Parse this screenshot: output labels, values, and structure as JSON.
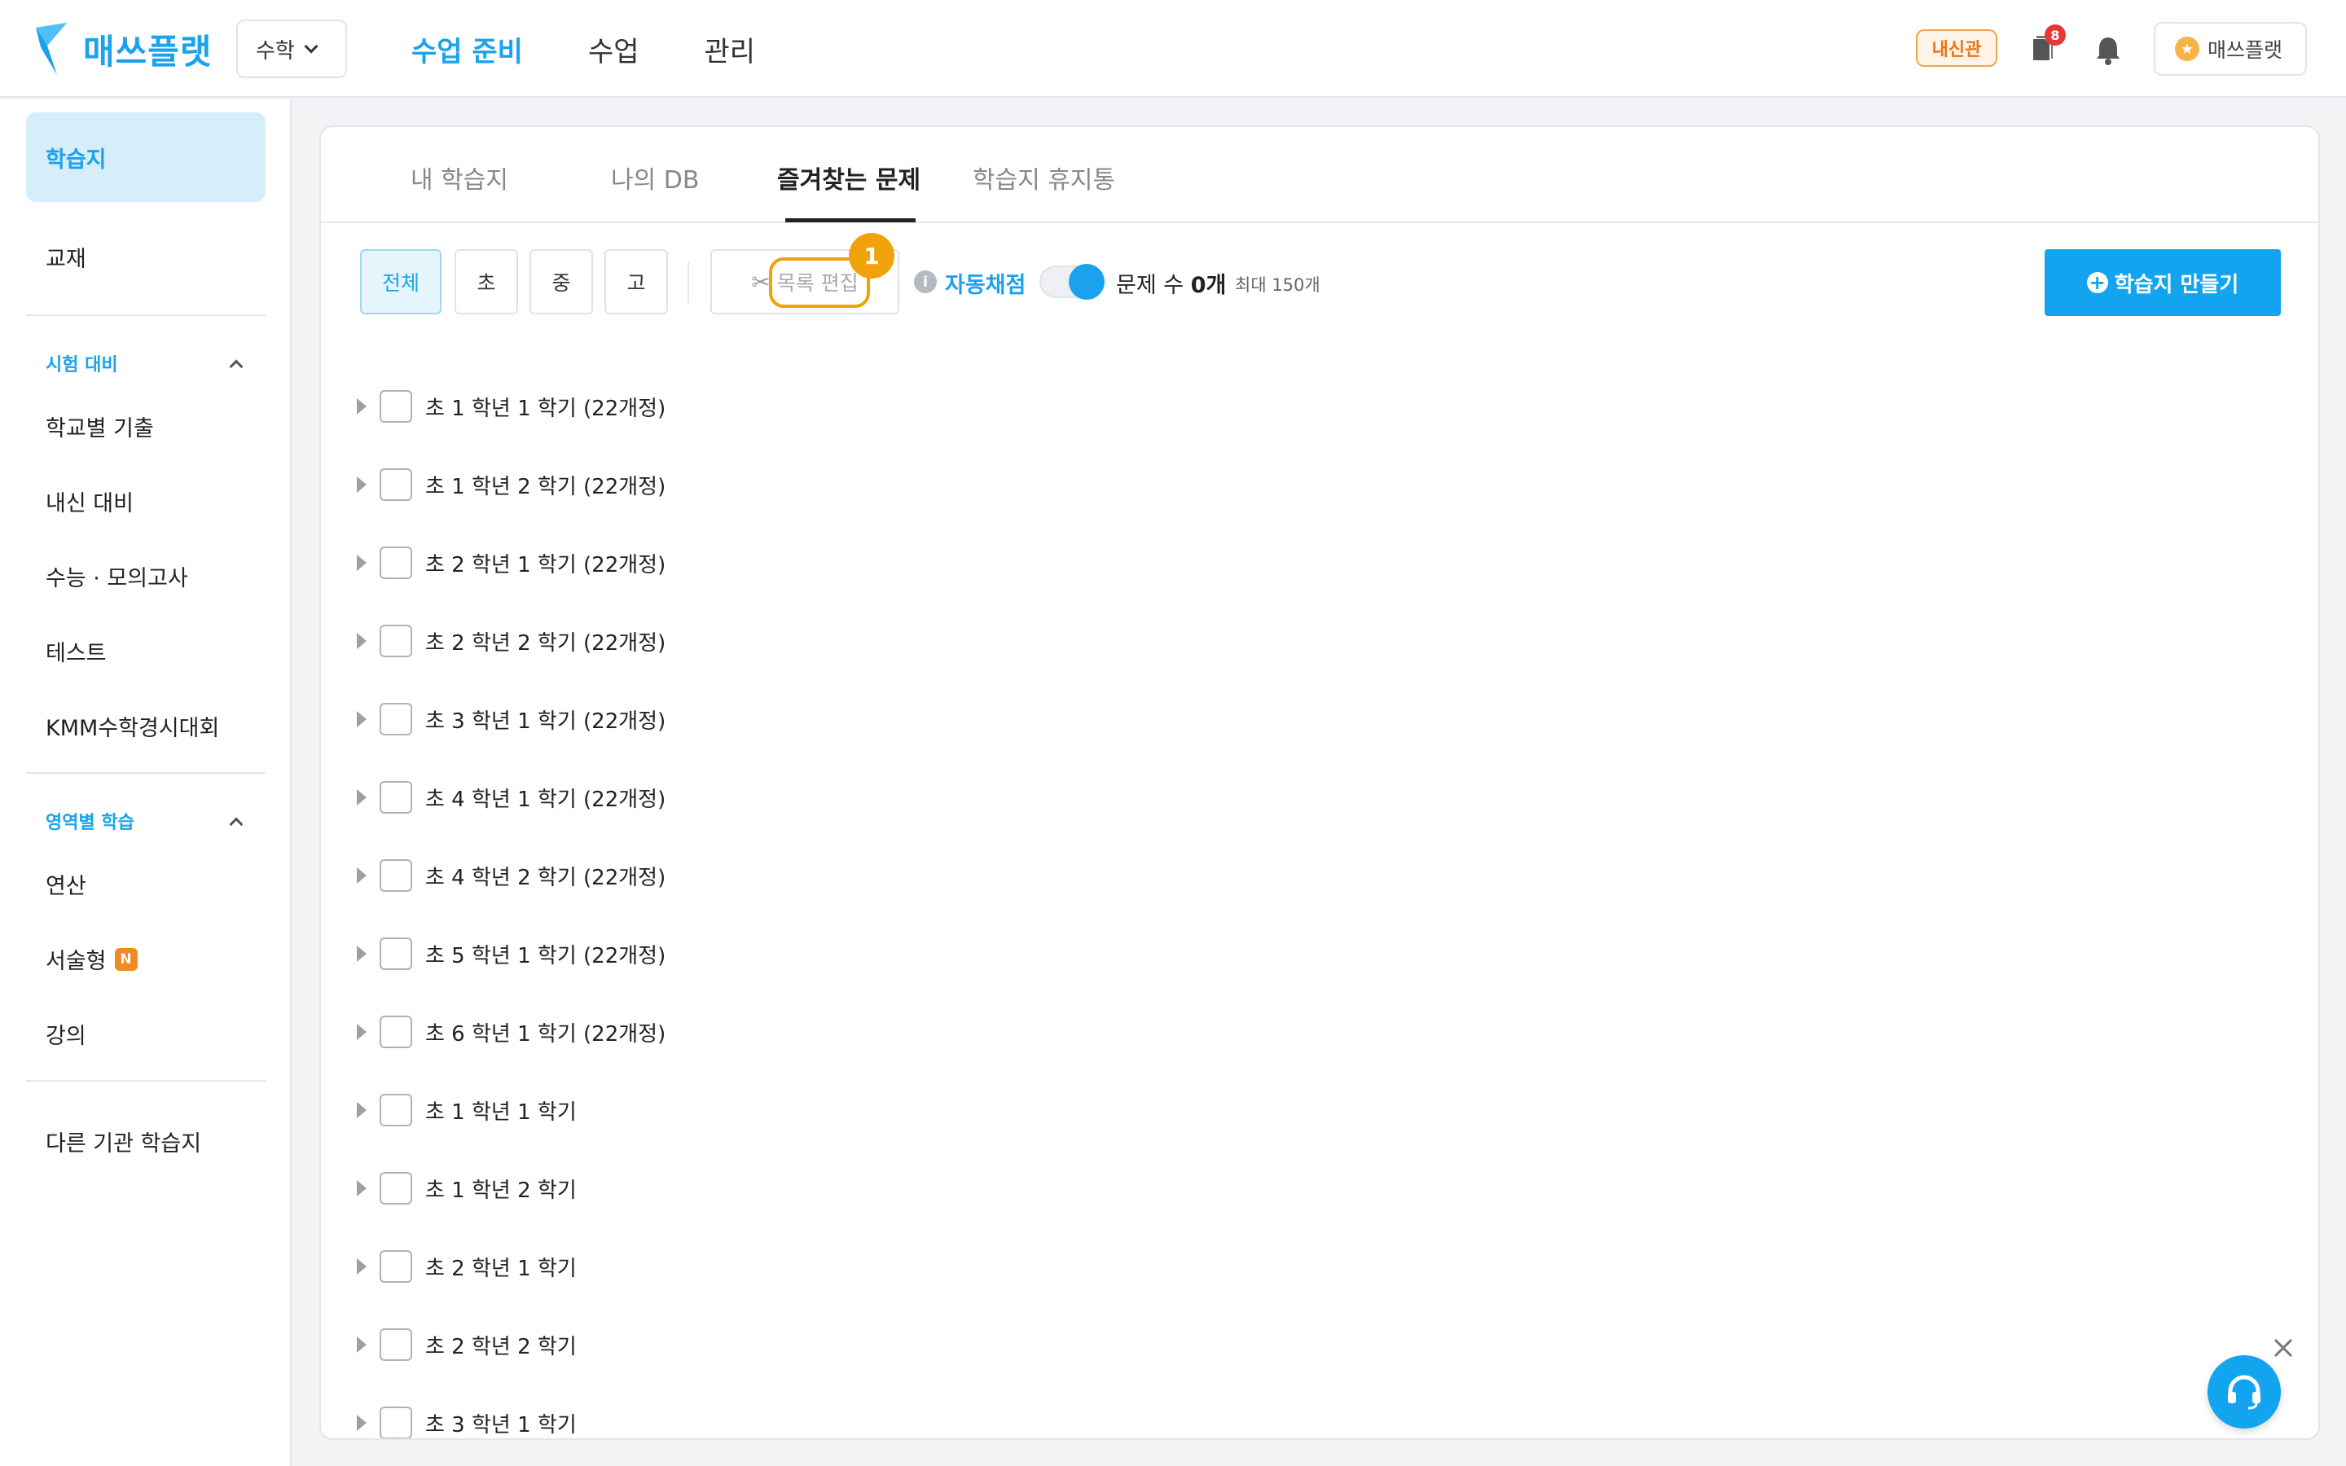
{
  "header": {
    "logo_text": "매쓰플랫",
    "subject": "수학",
    "nav": [
      "수업 준비",
      "수업",
      "관리"
    ],
    "badge": "내신관",
    "notification_count": "8",
    "user_label": "매쓰플랫"
  },
  "sidebar": {
    "worksheet": "학습지",
    "textbook": "교재",
    "exam_section": "시험 대비",
    "exam_items": [
      "학교별 기출",
      "내신 대비",
      "수능 · 모의고사",
      "테스트",
      "KMM수학경시대회"
    ],
    "area_section": "영역별 학습",
    "area_items": [
      "연산",
      "서술형",
      "강의"
    ],
    "new_badge": "N",
    "other": "다른 기관 학습지"
  },
  "tabs": [
    "내 학습지",
    "나의 DB",
    "즐겨찾는 문제",
    "학습지 휴지통"
  ],
  "toolbar": {
    "filters": [
      "전체",
      "초",
      "중",
      "고"
    ],
    "edit_label": "목록 편집",
    "step_number": "1",
    "auto_grade": "자동채점",
    "count_prefix": "문제 수",
    "count_value": "0개",
    "max_label": "최대 150개",
    "create_label": "학습지 만들기"
  },
  "tree_rows": [
    "초 1 학년 1 학기 (22개정)",
    "초 1 학년 2 학기 (22개정)",
    "초 2 학년 1 학기 (22개정)",
    "초 2 학년 2 학기 (22개정)",
    "초 3 학년 1 학기 (22개정)",
    "초 4 학년 1 학기 (22개정)",
    "초 4 학년 2 학기 (22개정)",
    "초 5 학년 1 학기 (22개정)",
    "초 6 학년 1 학기 (22개정)",
    "초 1 학년 1 학기",
    "초 1 학년 2 학기",
    "초 2 학년 1 학기",
    "초 2 학년 2 학기",
    "초 3 학년 1 학기"
  ],
  "colors": {
    "brand": "#1aa3ec",
    "highlight": "#f1a20b",
    "notification": "#e53935"
  }
}
